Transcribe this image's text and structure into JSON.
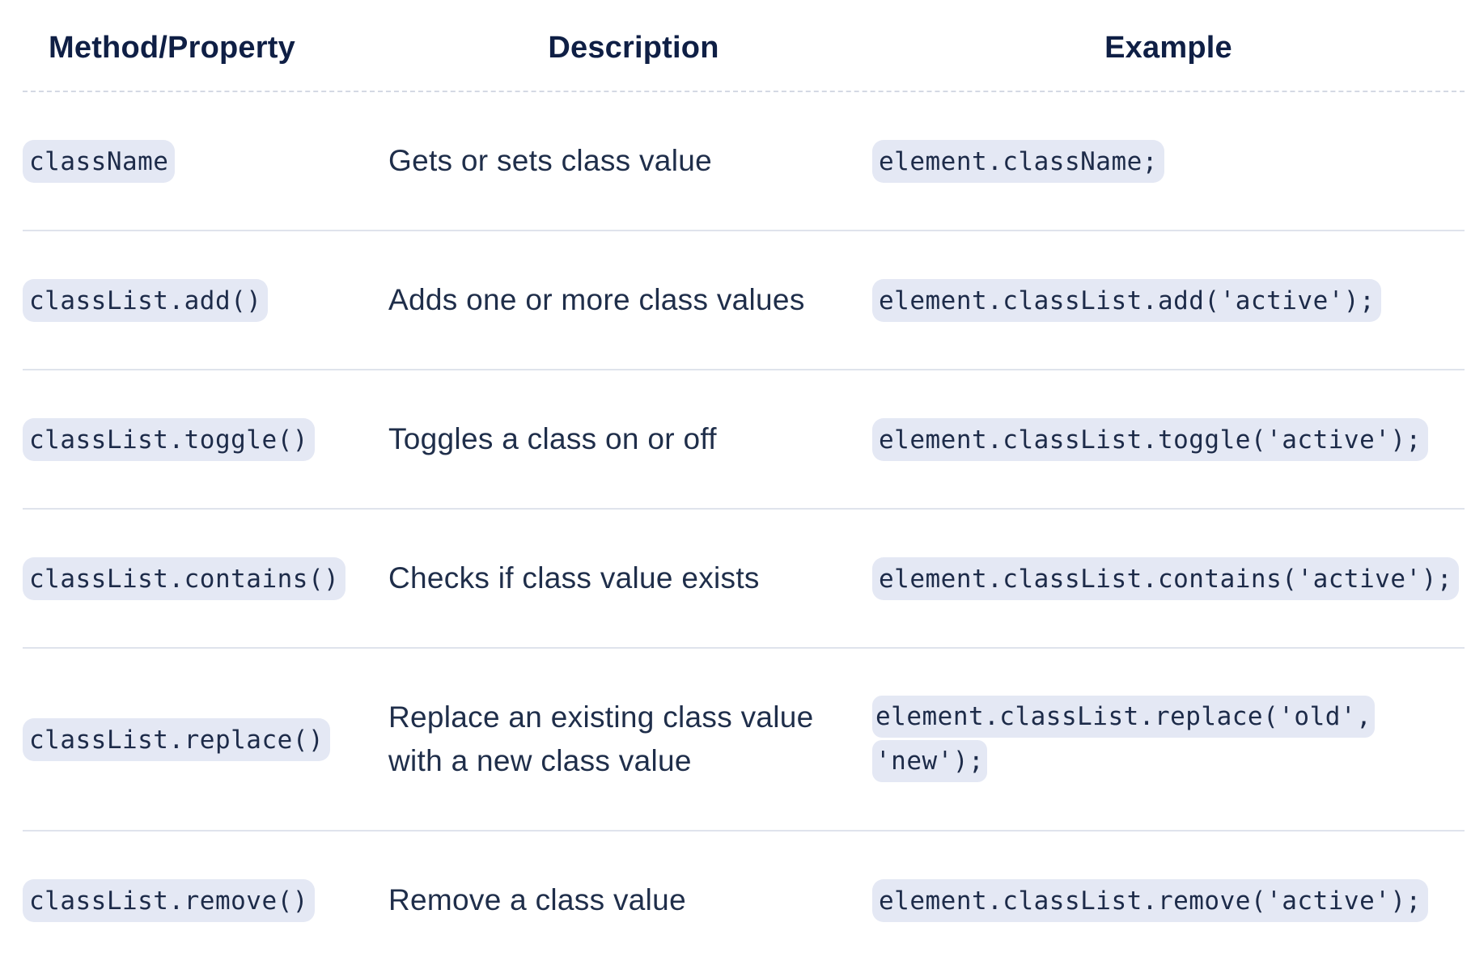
{
  "headers": {
    "method": "Method/Property",
    "description": "Description",
    "example": "Example"
  },
  "rows": [
    {
      "method": "className",
      "description": "Gets or sets class value",
      "example": "element.className;"
    },
    {
      "method": "classList.add()",
      "description": "Adds one or more class values",
      "example": "element.classList.add('active');"
    },
    {
      "method": "classList.toggle()",
      "description": "Toggles a class on or off",
      "example": "element.classList.toggle('active');"
    },
    {
      "method": "classList.contains()",
      "description": "Checks if class value exists",
      "example": "element.classList.contains('active');"
    },
    {
      "method": "classList.replace()",
      "description": "Replace an existing class value with a new class value",
      "example": "element.classList.replace('old', 'new');"
    },
    {
      "method": "classList.remove()",
      "description": "Remove a class value",
      "example": "element.classList.remove('active');"
    }
  ],
  "colors": {
    "heading_text": "#0f1f45",
    "body_text": "#1f2e4a",
    "code_background": "#e4e8f4",
    "divider": "#dfe3ec"
  }
}
